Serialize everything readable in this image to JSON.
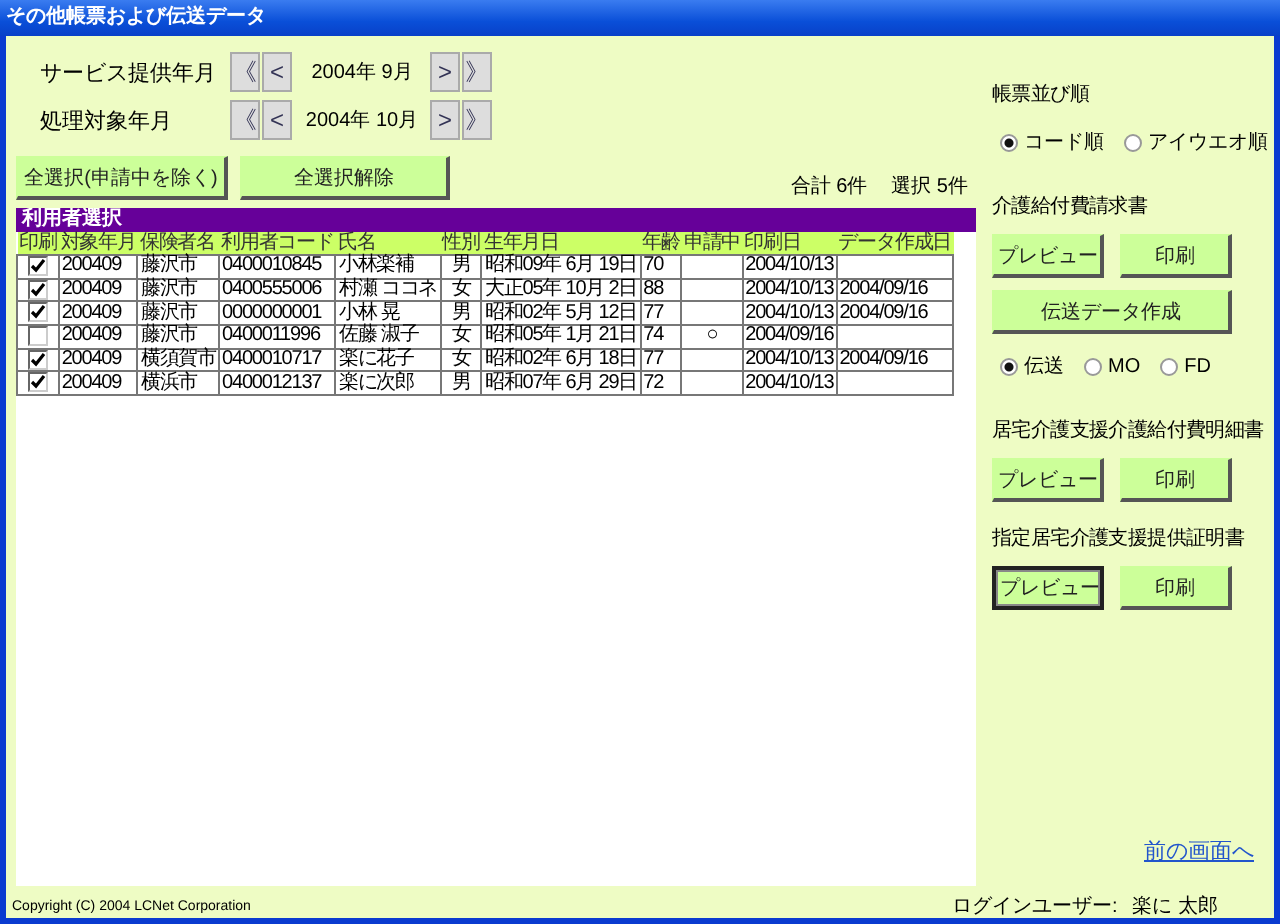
{
  "window": {
    "title": "その他帳票および伝送データ"
  },
  "periods": [
    {
      "label": "サービス提供年月",
      "first": "《",
      "prev": "<",
      "value": "2004年 9月",
      "next": ">",
      "last": "》"
    },
    {
      "label": "処理対象年月",
      "first": "《",
      "prev": "<",
      "value": "2004年 10月",
      "next": ">",
      "last": "》"
    }
  ],
  "select_buttons": [
    "全選択(申請中を除く)",
    "全選択解除"
  ],
  "totals": {
    "total": "合計 6件",
    "selected": "選択 5件"
  },
  "table": {
    "title": "利用者選択",
    "columns": [
      "印刷",
      "対象年月",
      "保険者名",
      "利用者コード",
      "氏名",
      "性別",
      "生年月日",
      "年齢",
      "申請中",
      "印刷日",
      "データ作成日"
    ],
    "rows": [
      {
        "checked": true,
        "cells": [
          "",
          "200409",
          "藤沢市",
          "0400010845",
          "小林楽補",
          "男",
          "昭和09年 6月 19日",
          "70",
          "",
          "2004/10/13",
          ""
        ]
      },
      {
        "checked": true,
        "cells": [
          "",
          "200409",
          "藤沢市",
          "0400555006",
          "村瀬 ココネ",
          "女",
          "大正05年 10月 2日",
          "88",
          "",
          "2004/10/13",
          "2004/09/16"
        ]
      },
      {
        "checked": true,
        "cells": [
          "",
          "200409",
          "藤沢市",
          "0000000001",
          "小林 晃",
          "男",
          "昭和02年 5月 12日",
          "77",
          "",
          "2004/10/13",
          "2004/09/16"
        ]
      },
      {
        "checked": false,
        "cells": [
          "",
          "200409",
          "藤沢市",
          "0400011996",
          "佐藤 淑子",
          "女",
          "昭和05年 1月 21日",
          "74",
          "○",
          "2004/09/16",
          ""
        ]
      },
      {
        "checked": true,
        "cells": [
          "",
          "200409",
          "横須賀市",
          "0400010717",
          "楽に花子",
          "女",
          "昭和02年 6月 18日",
          "77",
          "",
          "2004/10/13",
          "2004/09/16"
        ]
      },
      {
        "checked": true,
        "cells": [
          "",
          "200409",
          "横浜市",
          "0400012137",
          "楽に次郎",
          "男",
          "昭和07年 6月 29日",
          "72",
          "",
          "2004/10/13",
          ""
        ]
      }
    ]
  },
  "side": [
    {
      "kind": "heading",
      "text": "帳票並び順"
    },
    {
      "kind": "radios",
      "options": [
        {
          "label": "コード順",
          "selected": true
        },
        {
          "label": "アイウエオ順",
          "selected": false
        }
      ]
    },
    {
      "kind": "heading",
      "text": "介護給付費請求書"
    },
    {
      "kind": "buttons",
      "buttons": [
        {
          "label": "プレビュー",
          "focused": false
        },
        {
          "label": "印刷",
          "focused": false
        }
      ]
    },
    {
      "kind": "buttons",
      "buttons": [
        {
          "label": "伝送データ作成",
          "focused": false
        }
      ]
    },
    {
      "kind": "radios",
      "options": [
        {
          "label": "伝送",
          "selected": true
        },
        {
          "label": "MO",
          "selected": false
        },
        {
          "label": "FD",
          "selected": false
        }
      ]
    },
    {
      "kind": "heading",
      "text": "居宅介護支援介護給付費明細書"
    },
    {
      "kind": "buttons",
      "buttons": [
        {
          "label": "プレビュー",
          "focused": false
        },
        {
          "label": "印刷",
          "focused": false
        }
      ]
    },
    {
      "kind": "heading",
      "text": "指定居宅介護支援提供証明書"
    },
    {
      "kind": "buttons",
      "buttons": [
        {
          "label": "プレビュー",
          "focused": true
        },
        {
          "label": "印刷",
          "focused": false
        }
      ]
    }
  ],
  "back_link": "前の画面へ",
  "footer": {
    "copyright": "Copyright (C) 2004 LCNet Corporation",
    "login_label": "ログインユーザー:",
    "user": "楽に 太郎"
  }
}
